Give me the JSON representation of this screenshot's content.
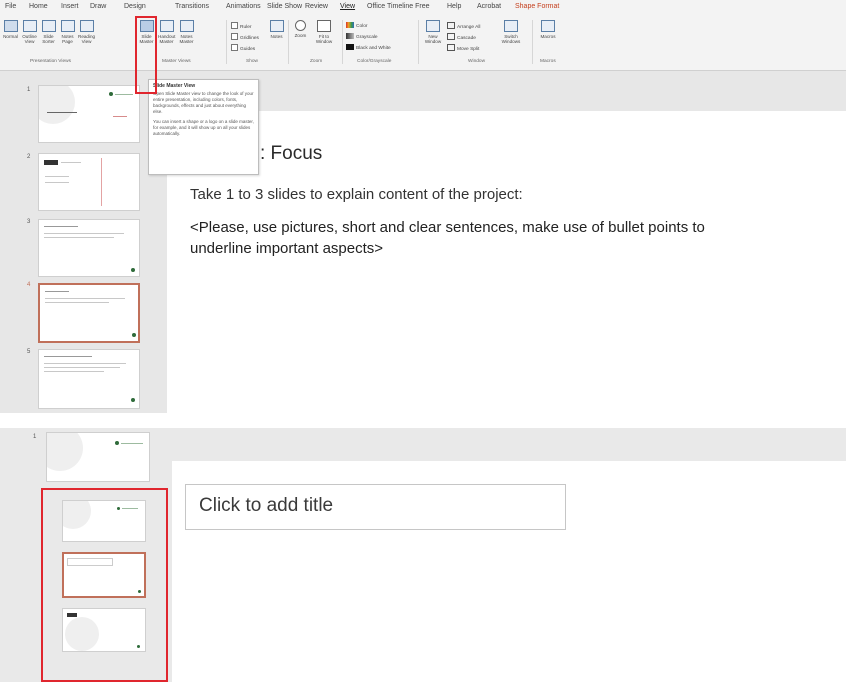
{
  "top": {
    "menu": [
      "File",
      "Home",
      "Insert",
      "Draw",
      "Design",
      "Transitions",
      "Animations",
      "Slide Show",
      "Review",
      "View",
      "Office Timeline Free",
      "Help",
      "Acrobat",
      "Shape Format"
    ],
    "active_menu": "View",
    "ribbon": {
      "presentation_views": [
        "Normal",
        "Outline View",
        "Slide Sorter",
        "Notes Page",
        "Reading View"
      ],
      "master_views": [
        "Slide Master",
        "Handout Master",
        "Notes Master"
      ],
      "show": [
        "Ruler",
        "Gridlines",
        "Guides"
      ],
      "notes": "Notes",
      "zoom": [
        "Zoom",
        "Fit to Window"
      ],
      "color": [
        "Color",
        "Grayscale",
        "Black and White"
      ],
      "window": [
        "New Window",
        "Arrange All",
        "Cascade",
        "Move Split",
        "Switch Windows"
      ],
      "macros": "Macros",
      "group_labels": [
        "Presentation Views",
        "Master Views",
        "Show",
        "Zoom",
        "Color/Grayscale",
        "Window",
        "Macros"
      ]
    },
    "tooltip": {
      "title": "Slide Master View",
      "body1": "Open Slide Master view to change the look of your entire presentation, including colors, fonts, backgrounds, effects and just about everything else.",
      "body2": "You can insert a shape or a logo on a slide master, for example, and it will show up on all your slides automatically."
    },
    "thumb_numbers": [
      "1",
      "2",
      "3",
      "4",
      "5"
    ],
    "slide": {
      "title": ": Focus",
      "line1": "Take 1 to 3 slides to explain content of the project:",
      "line2": "<Please, use pictures, short and clear sentences, make use of bullet points to underline important aspects>"
    }
  },
  "bottom": {
    "pane_number": "1",
    "title_placeholder": "Click to add title"
  },
  "colors": {
    "highlight_red": "#e0262e",
    "selected_thumb": "#c0705a",
    "logo_green": "#2f6b3a"
  }
}
